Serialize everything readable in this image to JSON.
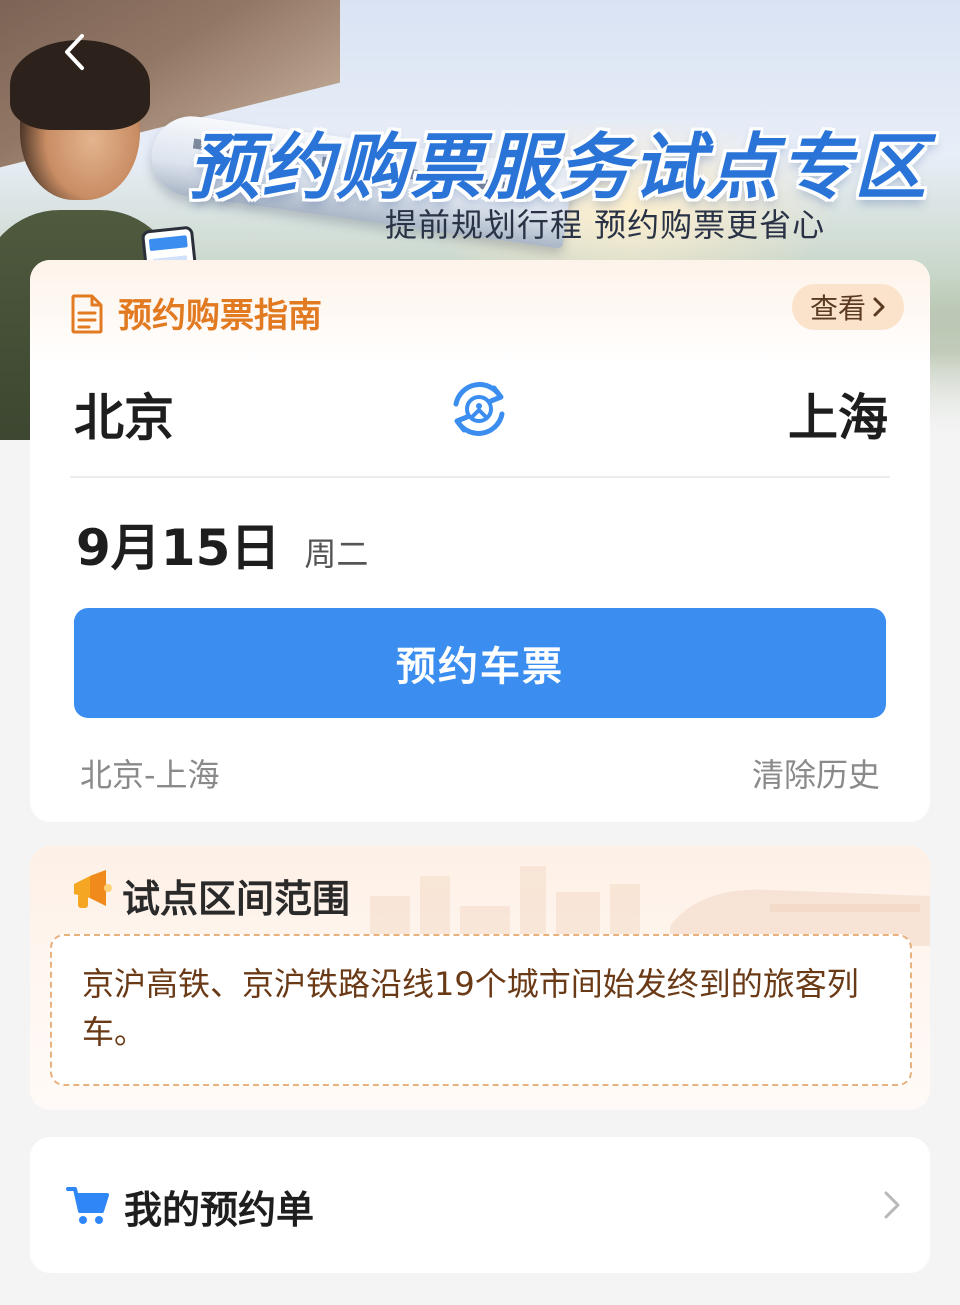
{
  "banner": {
    "title": "预约购票服务试点专区",
    "subtitle": "提前规划行程 预约购票更省心"
  },
  "guide": {
    "title": "预约购票指南",
    "view_label": "查看"
  },
  "route": {
    "from": "北京",
    "to": "上海"
  },
  "date": {
    "main": "9月15日",
    "weekday": "周二"
  },
  "book_button_label": "预约车票",
  "history": {
    "item": "北京-上海",
    "clear_label": "清除历史"
  },
  "scope": {
    "title": "试点区间范围",
    "text": "京沪高铁、京沪铁路沿线19个城市间始发终到的旅客列车。"
  },
  "orders": {
    "label": "我的预约单"
  },
  "colors": {
    "primary": "#3b8ef0",
    "accent_orange": "#e27a22",
    "background": "#f4f4f5"
  },
  "icons": [
    "back-arrow-icon",
    "document-icon",
    "chevron-right-icon",
    "swap-stations-icon",
    "megaphone-icon",
    "cart-icon"
  ]
}
